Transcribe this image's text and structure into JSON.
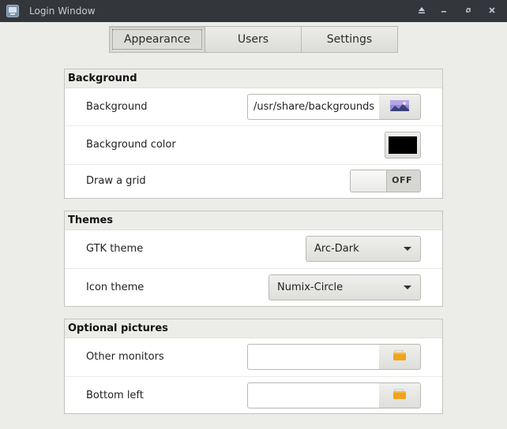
{
  "window": {
    "title": "Login Window"
  },
  "tabs": [
    {
      "label": "Appearance",
      "active": true
    },
    {
      "label": "Users",
      "active": false
    },
    {
      "label": "Settings",
      "active": false
    }
  ],
  "background_group": {
    "heading": "Background",
    "background_label": "Background",
    "background_path": "/usr/share/backgrounds",
    "background_color_label": "Background color",
    "background_color": "#000000",
    "grid_label": "Draw a grid",
    "grid_state": "OFF"
  },
  "themes_group": {
    "heading": "Themes",
    "gtk_label": "GTK theme",
    "gtk_value": "Arc-Dark",
    "icon_label": "Icon theme",
    "icon_value": "Numix-Circle"
  },
  "pictures_group": {
    "heading": "Optional pictures",
    "other_label": "Other monitors",
    "other_value": "",
    "bottom_label": "Bottom left",
    "bottom_value": ""
  },
  "colors": {
    "titlebar": "#33363b",
    "folder": "#f3a21c"
  },
  "icons": [
    "app-icon",
    "eject-icon",
    "minimize-icon",
    "restore-icon",
    "close-icon",
    "image-thumbnail-icon",
    "folder-icon"
  ]
}
